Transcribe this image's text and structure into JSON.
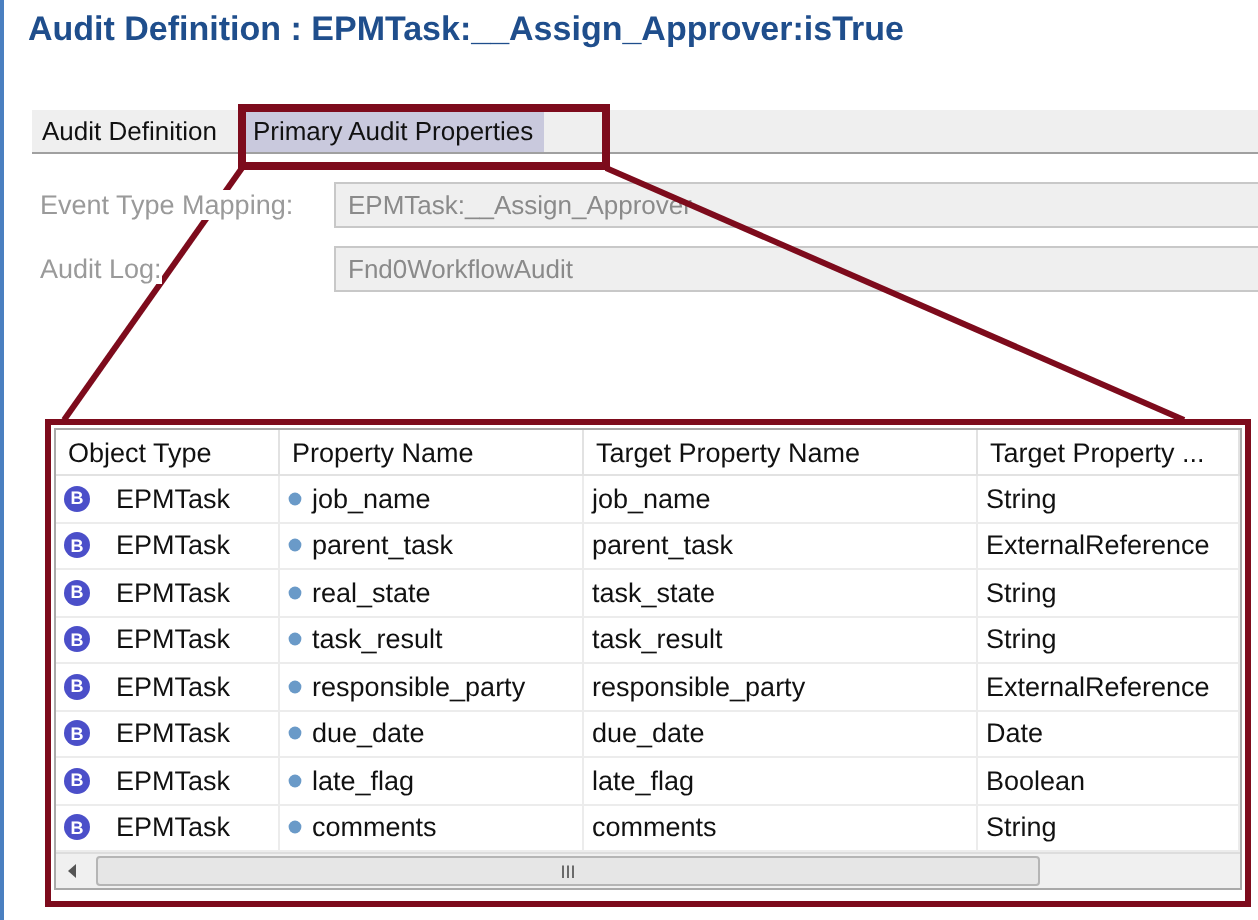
{
  "window": {
    "title": "Audit Definition : EPMTask:__Assign_Approver:isTrue"
  },
  "tabs": [
    {
      "label": "Audit Definition",
      "selected": false
    },
    {
      "label": "Primary Audit Properties",
      "selected": true
    }
  ],
  "fields": [
    {
      "label": "Event Type Mapping:",
      "value": "EPMTask:__Assign_Approver",
      "disabled": true
    },
    {
      "label": "Audit Log:",
      "value": "Fnd0WorkflowAudit",
      "disabled": true
    }
  ],
  "table": {
    "columns": [
      "Object Type",
      "Property Name",
      "Target Property Name",
      "Target Property ..."
    ],
    "rows": [
      {
        "badge": "B",
        "object_type": "EPMTask",
        "property_name": "job_name",
        "target_property_name": "job_name",
        "target_property_type": "String"
      },
      {
        "badge": "B",
        "object_type": "EPMTask",
        "property_name": "parent_task",
        "target_property_name": "parent_task",
        "target_property_type": "ExternalReference"
      },
      {
        "badge": "B",
        "object_type": "EPMTask",
        "property_name": "real_state",
        "target_property_name": "task_state",
        "target_property_type": "String"
      },
      {
        "badge": "B",
        "object_type": "EPMTask",
        "property_name": "task_result",
        "target_property_name": "task_result",
        "target_property_type": "String"
      },
      {
        "badge": "B",
        "object_type": "EPMTask",
        "property_name": "responsible_party",
        "target_property_name": "responsible_party",
        "target_property_type": "ExternalReference"
      },
      {
        "badge": "B",
        "object_type": "EPMTask",
        "property_name": "due_date",
        "target_property_name": "due_date",
        "target_property_type": "Date"
      },
      {
        "badge": "B",
        "object_type": "EPMTask",
        "property_name": "late_flag",
        "target_property_name": "late_flag",
        "target_property_type": "Boolean"
      },
      {
        "badge": "B",
        "object_type": "EPMTask",
        "property_name": "comments",
        "target_property_name": "comments",
        "target_property_type": "String"
      }
    ],
    "scrollbar_grip": "III"
  }
}
